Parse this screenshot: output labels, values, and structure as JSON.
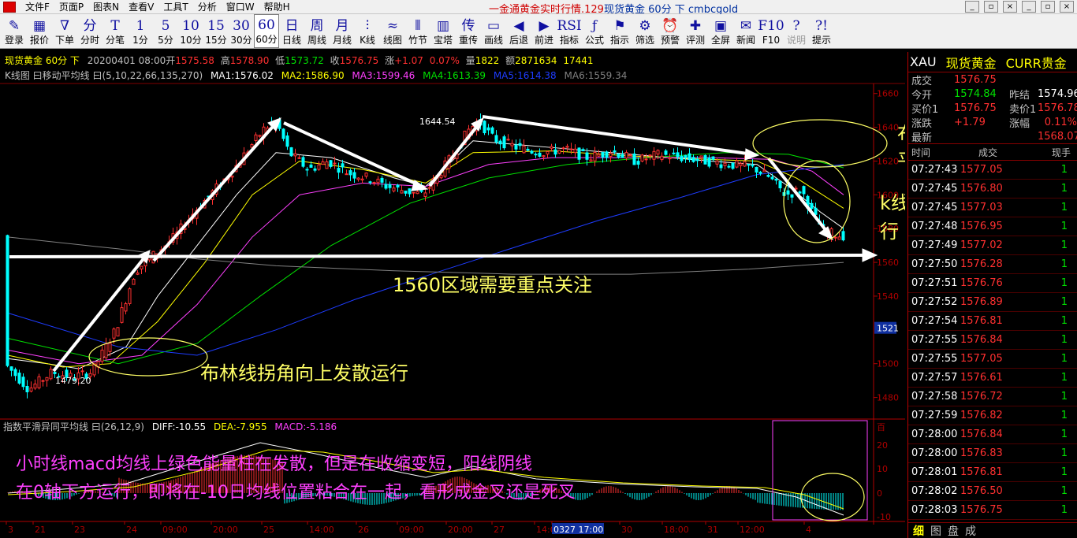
{
  "window": {
    "menus": [
      "文件F",
      "页面P",
      "图表N",
      "查看V",
      "工具T",
      "分析",
      "窗口W",
      "帮助H"
    ],
    "title_red": "一金通黄金实时行情.129",
    "title_blue": "现货黄金 60分 下 cmbcgold",
    "winbtns": [
      "_",
      "▫",
      "×",
      "_",
      "▫",
      "×"
    ]
  },
  "toolbar": [
    {
      "icon": "✎",
      "label": "登录",
      "name": "login"
    },
    {
      "icon": "▦",
      "label": "报价",
      "name": "quote"
    },
    {
      "icon": "∇",
      "label": "下单",
      "name": "order"
    },
    {
      "icon": "分",
      "label": "分时",
      "name": "timeshare"
    },
    {
      "icon": "T",
      "label": "分笔",
      "name": "ticks"
    },
    {
      "icon": "1",
      "label": "1分",
      "name": "m1"
    },
    {
      "icon": "5",
      "label": "5分",
      "name": "m5"
    },
    {
      "icon": "10",
      "label": "10分",
      "name": "m10"
    },
    {
      "icon": "15",
      "label": "15分",
      "name": "m15"
    },
    {
      "icon": "30",
      "label": "30分",
      "name": "m30"
    },
    {
      "icon": "60",
      "label": "60分",
      "name": "m60",
      "active": true
    },
    {
      "icon": "日",
      "label": "日线",
      "name": "daily"
    },
    {
      "icon": "周",
      "label": "周线",
      "name": "weekly"
    },
    {
      "icon": "月",
      "label": "月线",
      "name": "monthly"
    },
    {
      "icon": "⫶",
      "label": "K线",
      "name": "kline"
    },
    {
      "icon": "≈",
      "label": "线图",
      "name": "linechart"
    },
    {
      "icon": "⫴",
      "label": "竹节",
      "name": "bamboo"
    },
    {
      "icon": "▥",
      "label": "宝塔",
      "name": "pagoda"
    },
    {
      "icon": "传",
      "label": "重传",
      "name": "reload"
    },
    {
      "icon": "▭",
      "label": "画线",
      "name": "draw"
    },
    {
      "icon": "◀",
      "label": "后退",
      "name": "back"
    },
    {
      "icon": "▶",
      "label": "前进",
      "name": "forward"
    },
    {
      "icon": "RSI",
      "label": "指标",
      "name": "indicator"
    },
    {
      "icon": "ƒ",
      "label": "公式",
      "name": "formula"
    },
    {
      "icon": "⚑",
      "label": "指示",
      "name": "hint"
    },
    {
      "icon": "⚙",
      "label": "筛选",
      "name": "filter"
    },
    {
      "icon": "⏰",
      "label": "预警",
      "name": "alert"
    },
    {
      "icon": "✚",
      "label": "评测",
      "name": "evaluate"
    },
    {
      "icon": "▣",
      "label": "全屏",
      "name": "fullscreen"
    },
    {
      "icon": "✉",
      "label": "新闻",
      "name": "news"
    },
    {
      "icon": "F10",
      "label": "F10",
      "name": "f10"
    },
    {
      "icon": "?",
      "label": "说明",
      "name": "manual",
      "dim": true
    },
    {
      "icon": "?!",
      "label": "提示",
      "name": "tips"
    }
  ],
  "chart": {
    "info_line": {
      "symbol": "现货黄金 60分 下",
      "date": "20200401 08:00",
      "open_label": "开",
      "open": "1575.58",
      "high_label": "高",
      "high": "1578.90",
      "low_label": "低",
      "low": "1573.72",
      "close_label": "收",
      "close": "1576.75",
      "change_label": "涨",
      "change": "+1.07",
      "pct": "0.07%",
      "vol_label": "量",
      "vol": "1822",
      "amt_label": "额",
      "amt": "2871634",
      "oi": "17441"
    },
    "ma_line": {
      "title": "K线图 曰移动平均线 曰(5,10,22,66,135,270)",
      "ma1": "MA1:1576.02",
      "ma2": "MA2:1586.90",
      "ma3": "MA3:1599.46",
      "ma4": "MA4:1613.39",
      "ma5": "MA5:1614.38",
      "ma6": "MA6:1559.34"
    },
    "macd_line": {
      "title": "指数平滑异同平均线 曰(26,12,9)",
      "diff": "DIFF:-10.55",
      "dea": "DEA:-7.955",
      "macd": "MACD:-5.186"
    },
    "price_axis": [
      "1660",
      "1640",
      "1620",
      "1600",
      "1580",
      "1560",
      "1540",
      "1521",
      "1500",
      "1480"
    ],
    "macd_axis": [
      "百",
      "20",
      "10",
      "0",
      "-10"
    ],
    "x_axis": [
      "3",
      "21",
      "23",
      "24",
      "09:00",
      "20:00",
      "25",
      "14:00",
      "26",
      "09:00",
      "20:00",
      "27",
      "14:00",
      "0327 17:00",
      "30",
      "18:00",
      "31",
      "12:00",
      "4"
    ],
    "high_label": "1644.54",
    "low_label": "1479.20",
    "annotations": {
      "bollinger_flat": "布林线拐角向下",
      "bollinger_flat2": "平行运行",
      "kline_lower": "k线在布林线下轨运",
      "kline_lower2": "行",
      "focus_1560": "1560区域需要重点关注",
      "bollinger_up": "布林线拐角向上发散运行",
      "macd_note1": "小时线macd均线上绿色能量柱在发散，但是在收缩变短，阳线阴线",
      "macd_note2": "在0轴下方运行，即将在-10日均线位置粘合在一起，看形成金叉还是死叉"
    }
  },
  "quote": {
    "symbol": "XAU",
    "name": "现货黄金",
    "category": "CURR贵金",
    "last_label": "成交",
    "last": "1576.75",
    "open_label": "今开",
    "open": "1574.84",
    "prev_label": "昨结",
    "prev": "1574.96",
    "buy_label": "买价1",
    "buy": "1576.75",
    "sell_label": "卖价1",
    "sell": "1576.78",
    "chg_label": "涨跌",
    "chg": "+1.79",
    "pct_label": "涨幅",
    "pct": "0.11%",
    "avg_label": "最新",
    "avg": "1568.07",
    "tick_header": [
      "时间",
      "成交",
      "现手"
    ],
    "ticks": [
      [
        "07:27:43",
        "1577.05",
        "1"
      ],
      [
        "07:27:45",
        "1576.80",
        "1"
      ],
      [
        "07:27:45",
        "1577.03",
        "1"
      ],
      [
        "07:27:48",
        "1576.95",
        "1"
      ],
      [
        "07:27:49",
        "1577.02",
        "1"
      ],
      [
        "07:27:50",
        "1576.28",
        "1"
      ],
      [
        "07:27:51",
        "1576.76",
        "1"
      ],
      [
        "07:27:52",
        "1576.89",
        "1"
      ],
      [
        "07:27:54",
        "1576.81",
        "1"
      ],
      [
        "07:27:55",
        "1576.84",
        "1"
      ],
      [
        "07:27:55",
        "1577.05",
        "1"
      ],
      [
        "07:27:57",
        "1576.61",
        "1"
      ],
      [
        "07:27:58",
        "1576.72",
        "1"
      ],
      [
        "07:27:59",
        "1576.82",
        "1"
      ],
      [
        "07:28:00",
        "1576.84",
        "1"
      ],
      [
        "07:28:00",
        "1576.83",
        "1"
      ],
      [
        "07:28:01",
        "1576.81",
        "1"
      ],
      [
        "07:28:02",
        "1576.50",
        "1"
      ],
      [
        "07:28:03",
        "1576.75",
        "1"
      ]
    ],
    "tabs": [
      "细",
      "图",
      "盘",
      "成"
    ]
  },
  "colors": {
    "up": "#ff3030",
    "down": "#00ffff",
    "ma1": "#ffffff",
    "ma2": "#ffff00",
    "ma3": "#ff40ff",
    "ma4": "#00e000",
    "ma5": "#1e3cff",
    "ma6": "#808080",
    "axis": "#b00000"
  }
}
